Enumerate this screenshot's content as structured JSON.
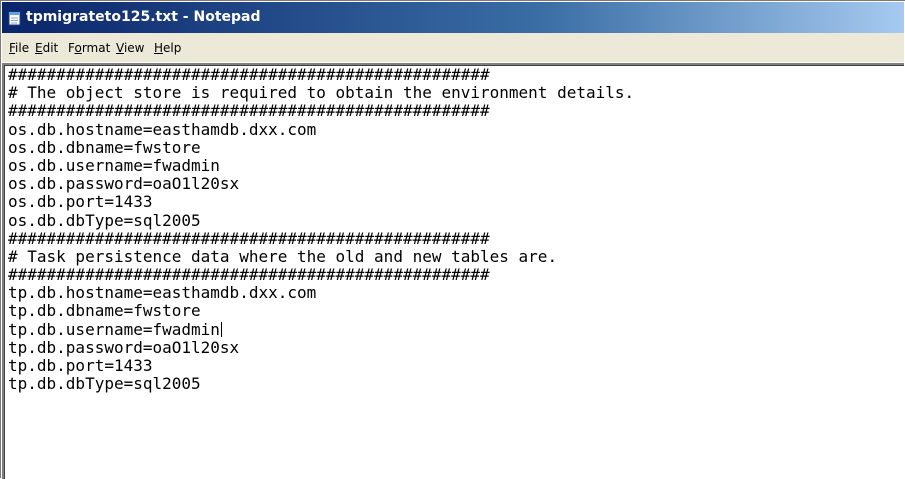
{
  "window": {
    "title": "tpmigrateto125.txt - Notepad",
    "title_icon": "notepad-icon",
    "colors": {
      "titlebar_start": "#0a246a",
      "titlebar_end": "#a6caf0",
      "menubar": "#ece9d8"
    }
  },
  "menu": [
    {
      "label": "File",
      "accel_index": 0
    },
    {
      "label": "Edit",
      "accel_index": 0
    },
    {
      "label": "Format",
      "accel_index": 1
    },
    {
      "label": "View",
      "accel_index": 0
    },
    {
      "label": "Help",
      "accel_index": 0
    }
  ],
  "editor": {
    "lines": [
      "##################################################",
      "# The object store is required to obtain the environment details.",
      "##################################################",
      "os.db.hostname=easthamdb.dxx.com",
      "os.db.dbname=fwstore",
      "os.db.username=fwadmin",
      "os.db.password=oaO1l20sx",
      "os.db.port=1433",
      "os.db.dbType=sql2005",
      "##################################################",
      "# Task persistence data where the old and new tables are.",
      "##################################################",
      "tp.db.hostname=easthamdb.dxx.com",
      "tp.db.dbname=fwstore",
      "tp.db.username=fwadmin",
      "tp.db.password=oaO1l20sx",
      "tp.db.port=1433",
      "tp.db.dbType=sql2005"
    ],
    "caret_line": 14
  }
}
